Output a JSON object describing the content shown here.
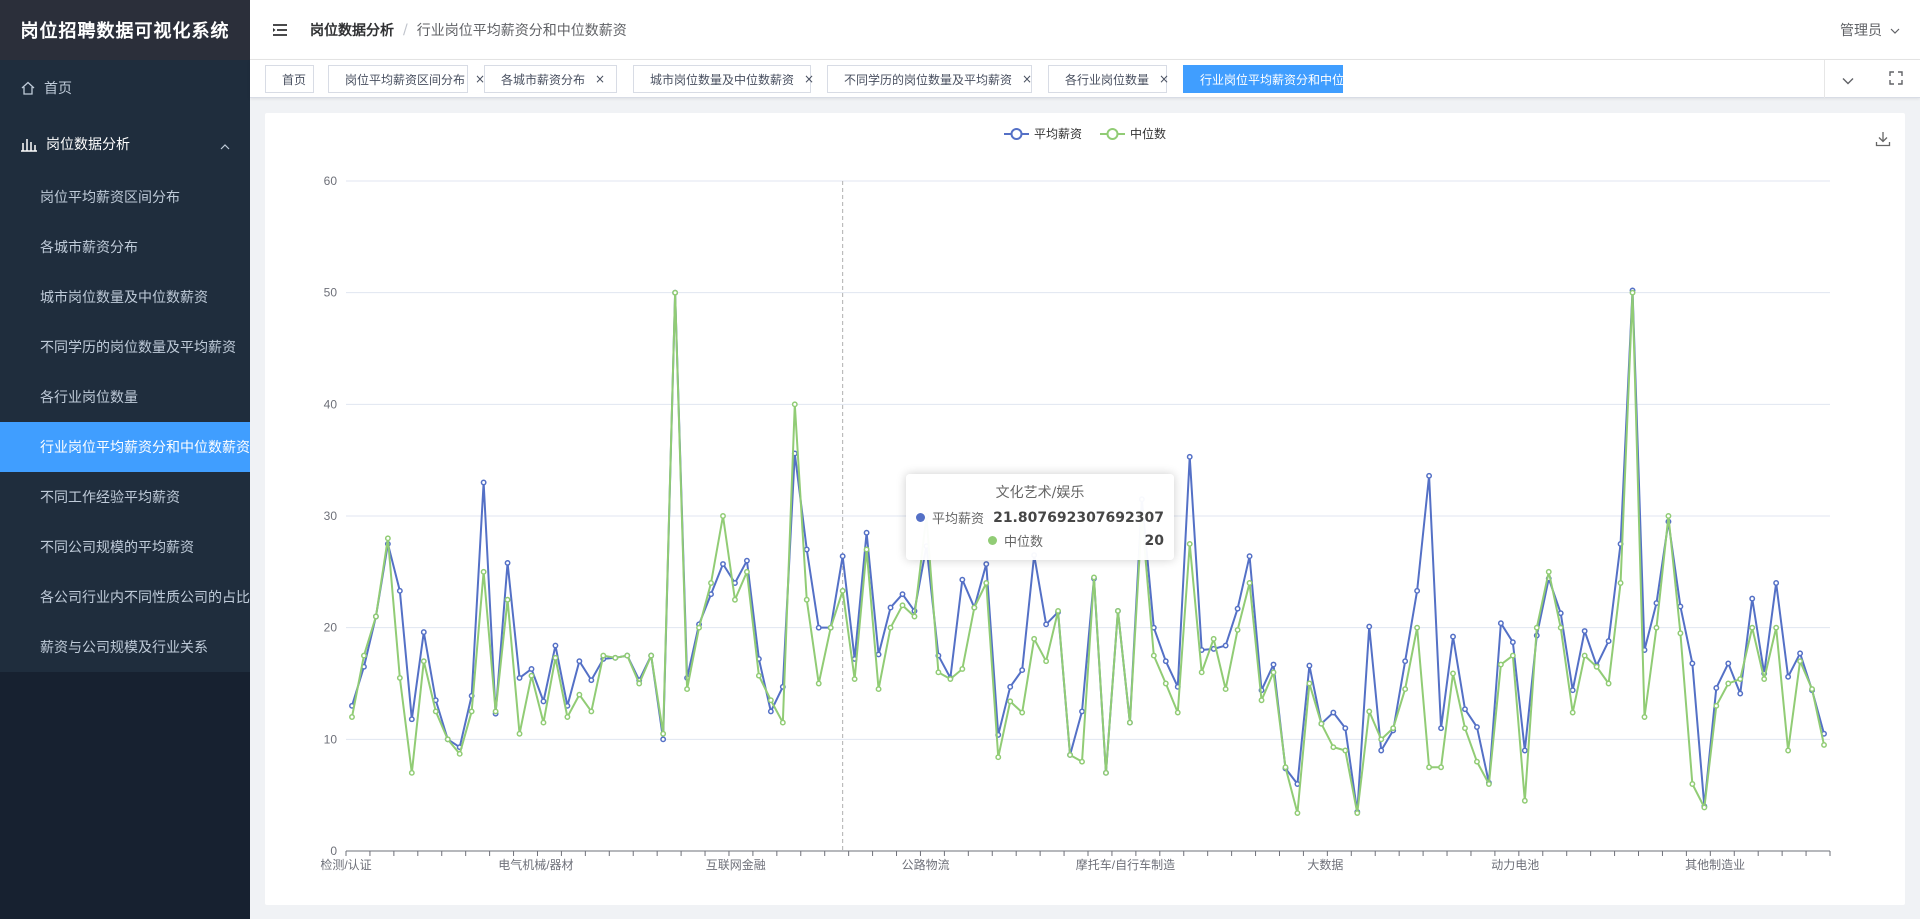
{
  "app": {
    "title": "岗位招聘数据可视化系统"
  },
  "sidebar": {
    "home_label": "首页",
    "group_label": "岗位数据分析",
    "items": [
      {
        "label": "岗位平均薪资区间分布",
        "active": false
      },
      {
        "label": "各城市薪资分布",
        "active": false
      },
      {
        "label": "城市岗位数量及中位数薪资",
        "active": false
      },
      {
        "label": "不同学历的岗位数量及平均薪资",
        "active": false
      },
      {
        "label": "各行业岗位数量",
        "active": false
      },
      {
        "label": "行业岗位平均薪资分和中位数薪资",
        "active": true
      },
      {
        "label": "不同工作经验平均薪资",
        "active": false
      },
      {
        "label": "不同公司规模的平均薪资",
        "active": false
      },
      {
        "label": "各公司行业内不同性质公司的占比",
        "active": false
      },
      {
        "label": "薪资与公司规模及行业关系",
        "active": false
      }
    ]
  },
  "navbar": {
    "breadcrumb": [
      "岗位数据分析",
      "行业岗位平均薪资分和中位数薪资"
    ],
    "user": "管理员"
  },
  "tags": [
    {
      "label": "首页",
      "closable": false,
      "active": false
    },
    {
      "label": "岗位平均薪资区间分布",
      "closable": true,
      "active": false
    },
    {
      "label": "各城市薪资分布",
      "closable": true,
      "active": false
    },
    {
      "label": "城市岗位数量及中位数薪资",
      "closable": true,
      "active": false
    },
    {
      "label": "不同学历的岗位数量及平均薪资",
      "closable": true,
      "active": false
    },
    {
      "label": "各行业岗位数量",
      "closable": true,
      "active": false
    },
    {
      "label": "行业岗位平均薪资分和中位数薪资",
      "closable": true,
      "active": true
    }
  ],
  "colors": {
    "avg": "#5470c6",
    "median": "#91cc75",
    "accent": "#409eff",
    "sidebar_bg": "#1f2d3d"
  },
  "tooltip": {
    "title": "文化艺术/娱乐",
    "rows": [
      {
        "name": "平均薪资",
        "value": "21.807692307692307"
      },
      {
        "name": "中位数",
        "value": "20"
      }
    ]
  },
  "chart_data": {
    "type": "line",
    "legend": [
      "平均薪资",
      "中位数"
    ],
    "x_tick_labels": [
      "检测/认证",
      "电气机械/器材",
      "互联网金融",
      "公路物流",
      "摩托车/自行车制造",
      "大数据",
      "动力电池",
      "其他制造业"
    ],
    "ylim": [
      0,
      60
    ],
    "yticks": [
      0,
      10,
      20,
      30,
      40,
      50,
      60
    ],
    "grid": true,
    "series": [
      {
        "name": "平均薪资",
        "values": [
          13,
          16.5,
          21,
          27.5,
          23.3,
          11.8,
          19.6,
          13.5,
          10,
          9.3,
          13.9,
          33,
          12.3,
          25.8,
          15.5,
          16.3,
          13.4,
          18.4,
          13,
          17,
          15.3,
          17.2,
          17.3,
          17.5,
          15.3,
          17.5,
          10,
          50,
          15.5,
          20.3,
          23,
          25.7,
          24,
          26,
          17.2,
          12.5,
          14.7,
          35.6,
          27,
          20,
          20,
          26.4,
          17.2,
          28.5,
          17.6,
          21.8,
          23,
          21.5,
          27.3,
          17.5,
          15.5,
          24.3,
          21.8,
          25.7,
          10.4,
          14.7,
          16.2,
          26.5,
          20.3,
          21.4,
          8.6,
          12.5,
          24.4,
          7,
          21.5,
          11.5,
          31.5,
          20,
          17,
          14.7,
          35.3,
          18,
          18.1,
          18.4,
          21.7,
          26.4,
          14.4,
          16.7,
          7.4,
          6,
          16.6,
          11.4,
          12.4,
          11,
          3.5,
          20.1,
          9,
          10.8,
          17,
          23.3,
          33.6,
          11,
          19.2,
          12.7,
          11.1,
          6.1,
          20.4,
          18.7,
          9,
          19.3,
          24.4,
          21.3,
          14.4,
          19.7,
          16.6,
          18.8,
          27.5,
          50.2,
          18,
          22.2,
          29.5,
          21.9,
          16.8,
          4,
          14.6,
          16.8,
          14.1,
          22.6,
          15.9,
          24,
          15.6,
          17.7,
          14.4,
          10.5
        ]
      },
      {
        "name": "中位数",
        "values": [
          12,
          17.5,
          21,
          28,
          15.5,
          7,
          17,
          12.5,
          10,
          8.7,
          12.5,
          25,
          12.5,
          22.5,
          10.5,
          15.7,
          11.5,
          17.3,
          12,
          14,
          12.5,
          17.5,
          17.3,
          17.5,
          15,
          17.5,
          10.5,
          50,
          14.5,
          20,
          24,
          30,
          22.5,
          25,
          15.7,
          13.5,
          11.5,
          40,
          22.5,
          15,
          20,
          23.3,
          15.4,
          27,
          14.5,
          20,
          22,
          21,
          30,
          16,
          15.4,
          16.3,
          21.8,
          24,
          8.4,
          13.4,
          12.4,
          19,
          17,
          21.5,
          8.6,
          8,
          24.5,
          7,
          21.5,
          11.5,
          30,
          17.5,
          15,
          12.4,
          27.5,
          16,
          19,
          14.5,
          19.8,
          24,
          13.5,
          16,
          7.5,
          3.4,
          15,
          11.4,
          9.3,
          9,
          3.4,
          12.5,
          10,
          11,
          14.5,
          20,
          7.5,
          7.5,
          15.9,
          11,
          8,
          6,
          16.7,
          17.5,
          4.5,
          20,
          25,
          20,
          12.4,
          17.5,
          16.5,
          15,
          24,
          50,
          12,
          20,
          30,
          19.5,
          6,
          3.9,
          13,
          15,
          15.4,
          20,
          15.4,
          20,
          9,
          17,
          14.5,
          9.5
        ]
      }
    ],
    "highlight_category": "文化艺术/娱乐"
  }
}
